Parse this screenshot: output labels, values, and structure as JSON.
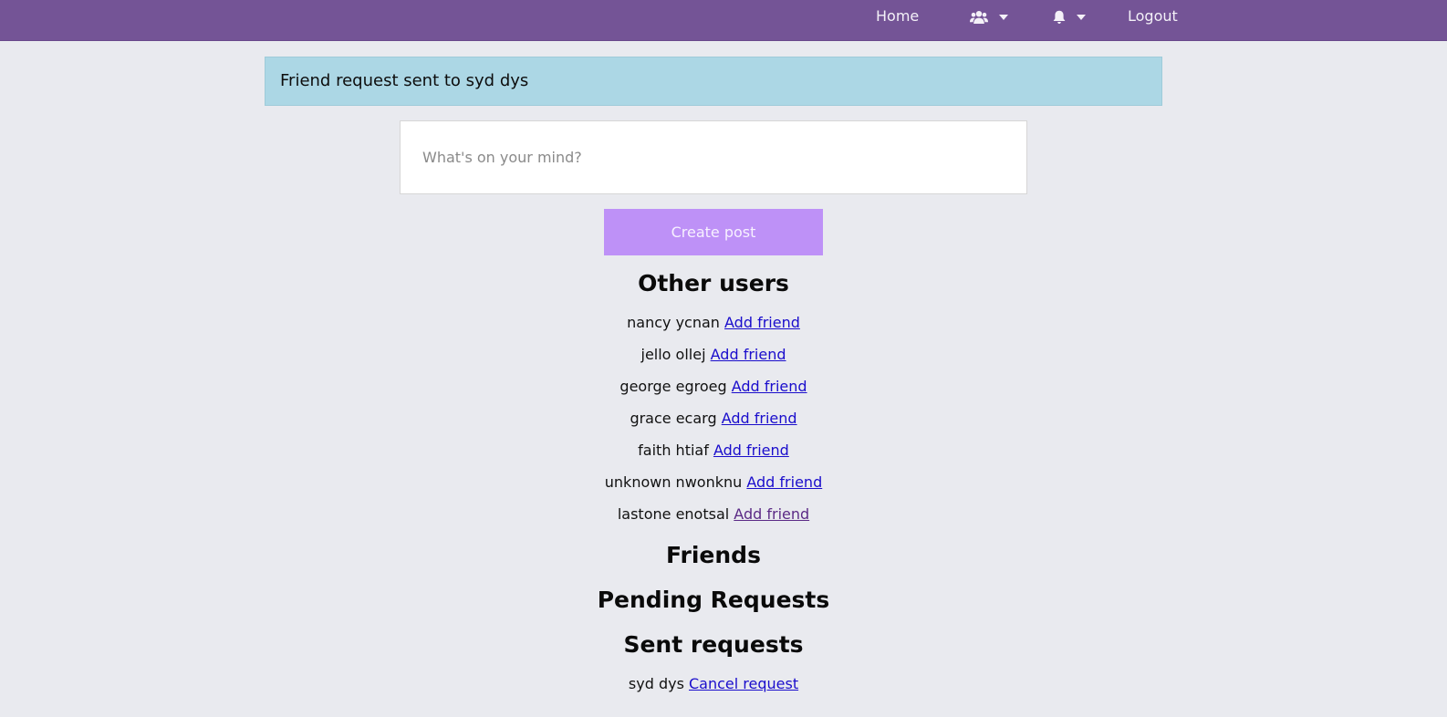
{
  "nav": {
    "home_label": "Home",
    "logout_label": "Logout",
    "friends_icon": "users-icon",
    "notifications_icon": "bell-icon",
    "background_color": "#745496"
  },
  "alert": {
    "message": "Friend request sent to syd dys",
    "background_color": "#acd7e5"
  },
  "composer": {
    "placeholder": "What's on your mind?",
    "create_label": "Create post",
    "button_color": "#be91f7"
  },
  "other_users": {
    "title": "Other users",
    "users": [
      {
        "name": "nancy ycnan",
        "action": "Add friend"
      },
      {
        "name": "jello ollej",
        "action": "Add friend"
      },
      {
        "name": "george egroeg",
        "action": "Add friend"
      },
      {
        "name": "grace ecarg",
        "action": "Add friend"
      },
      {
        "name": "faith htiaf",
        "action": "Add friend"
      },
      {
        "name": "unknown nwonknu",
        "action": "Add friend"
      },
      {
        "name": "lastone enotsal",
        "action": "Add friend"
      }
    ]
  },
  "friends": {
    "title": "Friends"
  },
  "pending": {
    "title": "Pending Requests"
  },
  "sent": {
    "title": "Sent requests",
    "requests": [
      {
        "name": "syd dys",
        "action": "Cancel request"
      }
    ]
  }
}
